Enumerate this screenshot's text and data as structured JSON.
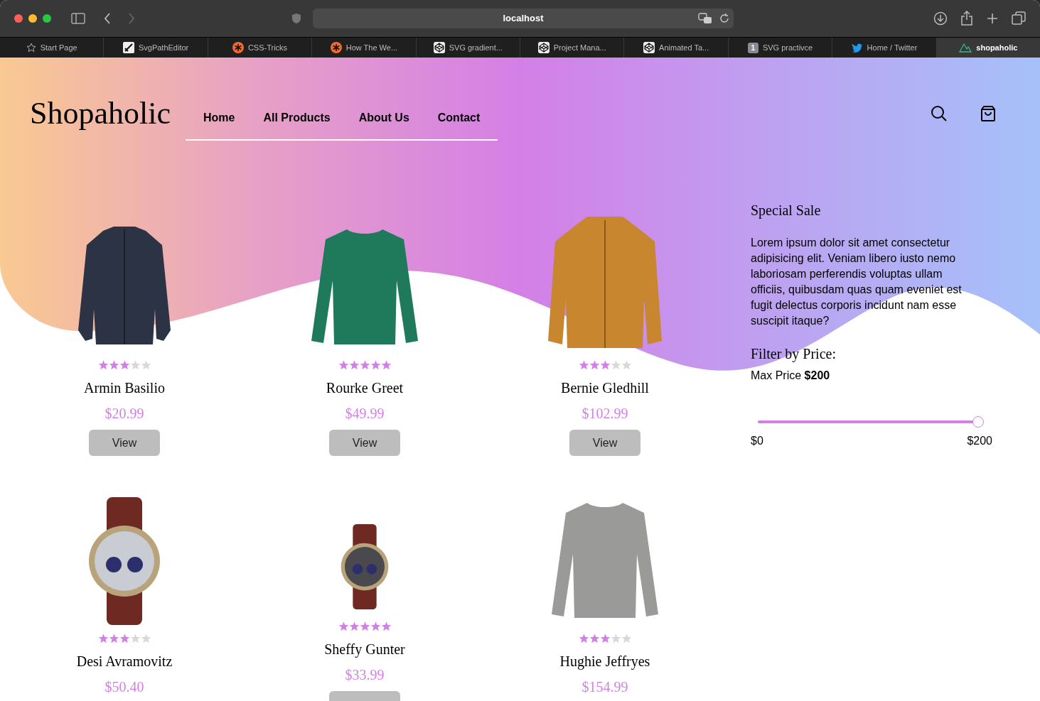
{
  "browser": {
    "address": "localhost",
    "tabs": [
      {
        "label": "Start Page",
        "kind": "star",
        "selected": false
      },
      {
        "label": "SvgPathEditor",
        "kind": "pen",
        "selected": false
      },
      {
        "label": "CSS-Tricks",
        "kind": "asterisk",
        "selected": false
      },
      {
        "label": "How The We...",
        "kind": "asterisk",
        "selected": false
      },
      {
        "label": "SVG gradient...",
        "kind": "cube",
        "selected": false
      },
      {
        "label": "Project Mana...",
        "kind": "cube",
        "selected": false
      },
      {
        "label": "Animated Ta...",
        "kind": "cube",
        "selected": false
      },
      {
        "label": "SVG practivce",
        "kind": "number",
        "badge": "1",
        "selected": false
      },
      {
        "label": "Home / Twitter",
        "kind": "bird",
        "selected": false
      },
      {
        "label": "shopaholic",
        "kind": "mountain",
        "selected": true
      }
    ]
  },
  "header": {
    "logo": "Shopaholic",
    "nav": [
      "Home",
      "All Products",
      "About Us",
      "Contact"
    ]
  },
  "products": [
    {
      "name": "Armin Basilio",
      "price": "$20.99",
      "stars": 3,
      "kind": "jacket",
      "button": "View"
    },
    {
      "name": "Rourke Greet",
      "price": "$49.99",
      "stars": 5,
      "kind": "sweater",
      "button": "View"
    },
    {
      "name": "Bernie Gledhill",
      "price": "$102.99",
      "stars": 3,
      "kind": "bomber",
      "button": "View"
    },
    {
      "name": "Desi Avramovitz",
      "price": "$50.40",
      "stars": 3,
      "kind": "watch"
    },
    {
      "name": "Sheffy Gunter",
      "price": "$33.99",
      "stars": 5,
      "kind": "watch"
    },
    {
      "name": "Hughie Jeffryes",
      "price": "$154.99",
      "stars": 3,
      "kind": "sweater"
    }
  ],
  "sidebar": {
    "title": "Special Sale",
    "text": "Lorem ipsum dolor sit amet consectetur adipisicing elit. Veniam libero iusto nemo laboriosam perferendis voluptas ullam officiis, quibusdam quas quam eveniet est fugit delectus corporis incidunt nam esse suscipit itaque?",
    "filter_title": "Filter by Price:",
    "max_price": "Max Price **$200**",
    "slider": {
      "level": 1,
      "min": "$0",
      "max": "$200"
    }
  }
}
